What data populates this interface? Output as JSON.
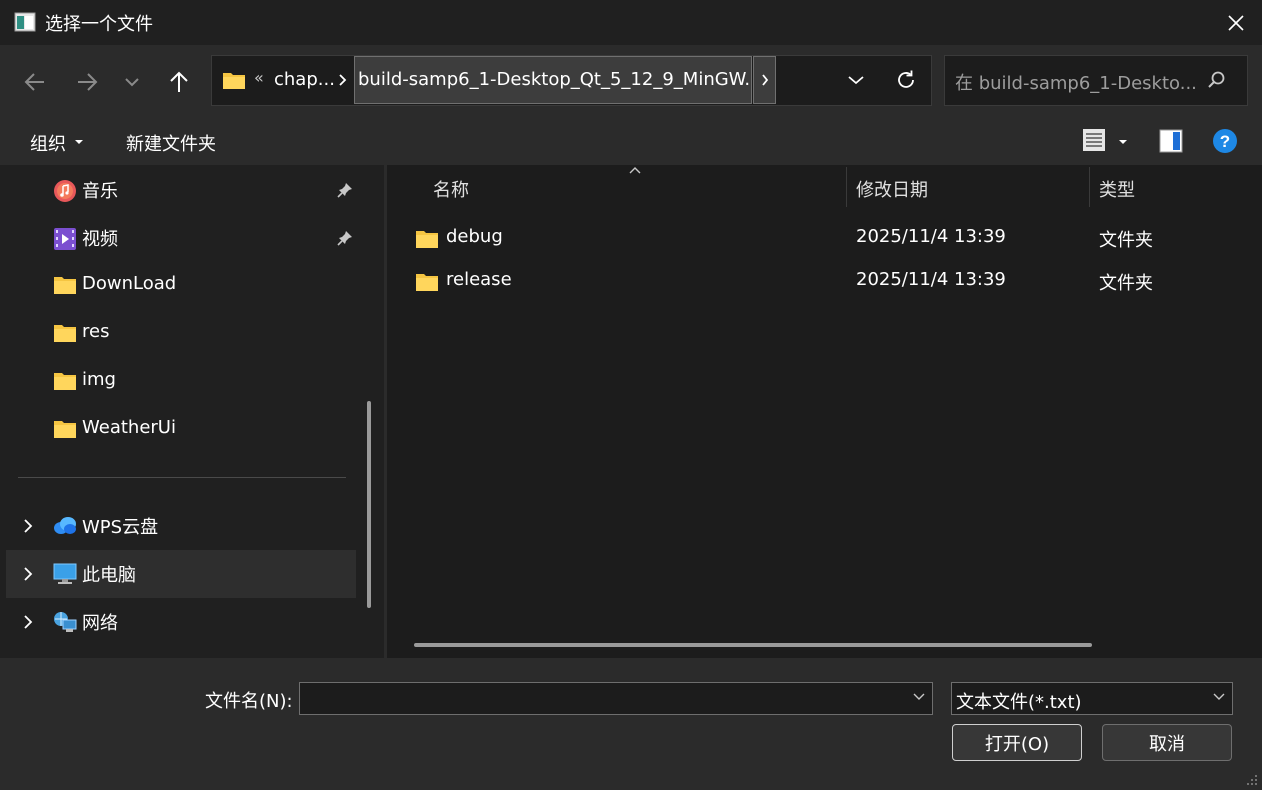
{
  "window": {
    "title": "选择一个文件",
    "icon": "app-window-icon",
    "close_icon": "close-icon"
  },
  "nav": {
    "back_icon": "arrow-left-icon",
    "forward_icon": "arrow-right-icon",
    "recent_icon": "chevron-down-icon",
    "up_icon": "arrow-up-icon",
    "breadcrumb": {
      "overflow": "«",
      "parent": "chap...",
      "current": "build-samp6_1-Desktop_Qt_5_12_9_MinGW..."
    },
    "refresh_icon": "refresh-icon",
    "search_placeholder": "在 build-samp6_1-Deskto..."
  },
  "commands": {
    "organize": "组织",
    "new_folder": "新建文件夹",
    "view_icon": "list-view-icon",
    "preview_icon": "preview-pane-icon",
    "help_icon": "help-icon"
  },
  "sidebar": {
    "pinned": [
      {
        "label": "音乐",
        "icon": "music-icon",
        "pinned": true
      },
      {
        "label": "视频",
        "icon": "video-icon",
        "pinned": true
      },
      {
        "label": "DownLoad",
        "icon": "folder-icon",
        "pinned": false
      },
      {
        "label": "res",
        "icon": "folder-icon",
        "pinned": false
      },
      {
        "label": "img",
        "icon": "folder-icon",
        "pinned": false
      },
      {
        "label": "WeatherUi",
        "icon": "folder-icon",
        "pinned": false
      }
    ],
    "locations": [
      {
        "label": "WPS云盘",
        "icon": "cloud-icon",
        "selected": false
      },
      {
        "label": "此电脑",
        "icon": "computer-icon",
        "selected": true
      },
      {
        "label": "网络",
        "icon": "network-icon",
        "selected": false
      }
    ]
  },
  "filelist": {
    "columns": {
      "name": "名称",
      "date": "修改日期",
      "type": "类型"
    },
    "rows": [
      {
        "name": "debug",
        "date": "2025/11/4 13:39",
        "type": "文件夹"
      },
      {
        "name": "release",
        "date": "2025/11/4 13:39",
        "type": "文件夹"
      }
    ]
  },
  "footer": {
    "filename_label": "文件名(N):",
    "filename_value": "",
    "filter_value": "文本文件(*.txt)",
    "open_label": "打开(O)",
    "cancel_label": "取消"
  },
  "colors": {
    "folder": "#f5c542",
    "accent": "#0a84ff",
    "background": "#1c1c1c"
  }
}
